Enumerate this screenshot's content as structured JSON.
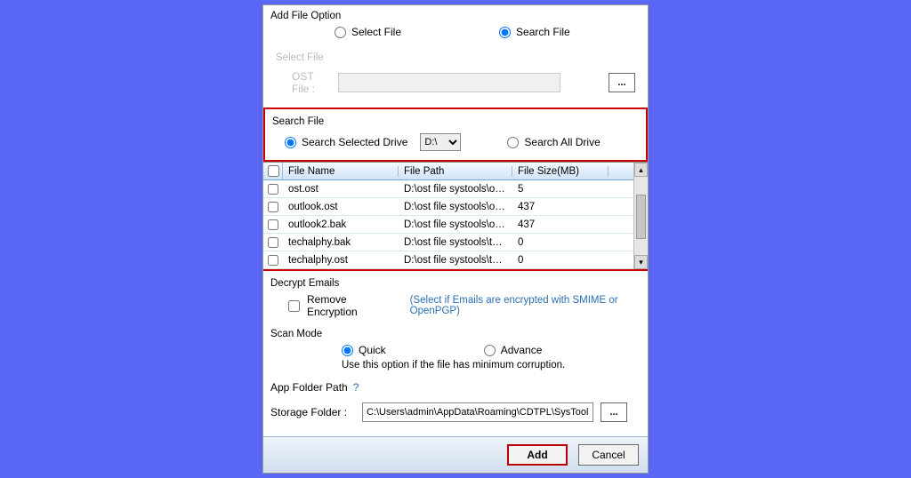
{
  "addFileOption": {
    "label": "Add File Option",
    "selectRadio": "Select File",
    "searchRadio": "Search File",
    "selected": "search"
  },
  "selectFile": {
    "label": "Select File",
    "ostLabel": "OST File :",
    "ostValue": "",
    "browse": "..."
  },
  "searchFile": {
    "label": "Search File",
    "selectedDriveRadio": "Search Selected Drive",
    "allDriveRadio": "Search All Drive",
    "driveOptions": [
      "D:\\"
    ],
    "driveValue": "D:\\",
    "radioSelected": "selected"
  },
  "table": {
    "headers": {
      "name": "File Name",
      "path": "File Path",
      "size": "File Size(MB)"
    },
    "rows": [
      {
        "name": "ost.ost",
        "path": "D:\\ost file systools\\ost.ost",
        "size": "5"
      },
      {
        "name": "outlook.ost",
        "path": "D:\\ost file systools\\outloo...",
        "size": "437"
      },
      {
        "name": "outlook2.bak",
        "path": "D:\\ost file systools\\outloo...",
        "size": "437"
      },
      {
        "name": "techalphy.bak",
        "path": "D:\\ost file systools\\techal...",
        "size": "0"
      },
      {
        "name": "techalphy.ost",
        "path": "D:\\ost file systools\\techal...",
        "size": "0"
      }
    ]
  },
  "decrypt": {
    "label": "Decrypt Emails",
    "checkbox": "Remove Encryption",
    "hint": "(Select if Emails are encrypted with SMIME or OpenPGP)"
  },
  "scanMode": {
    "label": "Scan Mode",
    "quick": "Quick",
    "advance": "Advance",
    "hint": "Use this option if the file has minimum corruption.",
    "selected": "quick"
  },
  "appFolder": {
    "label": "App Folder Path",
    "help": "?"
  },
  "storage": {
    "label": "Storage Folder   :",
    "value": "C:\\Users\\admin\\AppData\\Roaming\\CDTPL\\SysTools O",
    "browse": "..."
  },
  "footer": {
    "add": "Add",
    "cancel": "Cancel"
  }
}
